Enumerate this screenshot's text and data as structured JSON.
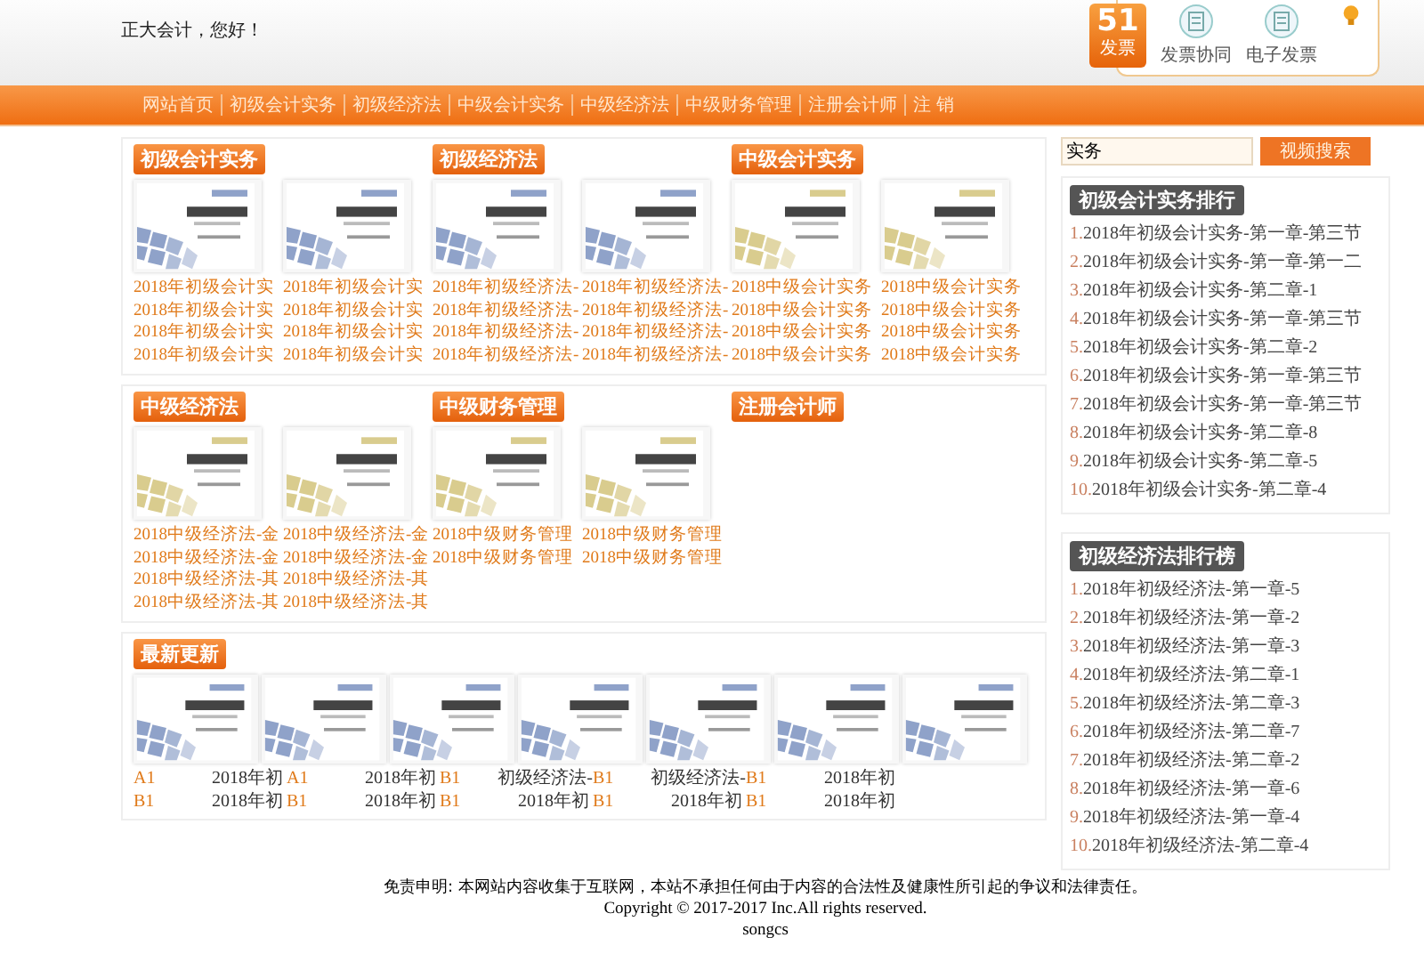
{
  "header": {
    "greeting": "正大会计，您好！",
    "badge_number": "51",
    "badge_label": "发票",
    "apps": [
      {
        "label": "发票协同"
      },
      {
        "label": "电子发票"
      }
    ]
  },
  "nav": [
    "网站首页",
    "初级会计实务",
    "初级经济法",
    "中级会计实务",
    "中级经济法",
    "中级财务管理",
    "注册会计师",
    "注 销"
  ],
  "sections": [
    {
      "title": "初级会计实务",
      "books": [
        {
          "color": "#8fa2c9",
          "links": [
            "2018年初级会计实",
            "2018年初级会计实",
            "2018年初级会计实",
            "2018年初级会计实"
          ]
        },
        {
          "color": "#8fa2c9",
          "links": [
            "2018年初级会计实",
            "2018年初级会计实",
            "2018年初级会计实",
            "2018年初级会计实"
          ]
        }
      ]
    },
    {
      "title": "初级经济法",
      "books": [
        {
          "color": "#8fa2c9",
          "links": [
            "2018年初级经济法-",
            "2018年初级经济法-",
            "2018年初级经济法-",
            "2018年初级经济法-"
          ]
        },
        {
          "color": "#8fa2c9",
          "links": [
            "2018年初级经济法-",
            "2018年初级经济法-",
            "2018年初级经济法-",
            "2018年初级经济法-"
          ]
        }
      ]
    },
    {
      "title": "中级会计实务",
      "books": [
        {
          "color": "#d9cc8e",
          "links": [
            "2018中级会计实务",
            "2018中级会计实务",
            "2018中级会计实务",
            "2018中级会计实务"
          ]
        },
        {
          "color": "#d9cc8e",
          "links": [
            "2018中级会计实务",
            "2018中级会计实务",
            "2018中级会计实务",
            "2018中级会计实务"
          ]
        }
      ]
    },
    {
      "title": "中级经济法",
      "books": [
        {
          "color": "#d9cc8e",
          "links": [
            "2018中级经济法-金",
            "2018中级经济法-金",
            "2018中级经济法-其",
            "2018中级经济法-其"
          ]
        },
        {
          "color": "#d9cc8e",
          "links": [
            "2018中级经济法-金",
            "2018中级经济法-金",
            "2018中级经济法-其",
            "2018中级经济法-其"
          ]
        }
      ]
    },
    {
      "title": "中级财务管理",
      "books": [
        {
          "color": "#d9cc8e",
          "links": [
            "2018中级财务管理",
            "2018中级财务管理"
          ]
        },
        {
          "color": "#d9cc8e",
          "links": [
            "2018中级财务管理",
            "2018中级财务管理"
          ]
        }
      ]
    },
    {
      "title": "注册会计师"
    }
  ],
  "latest": {
    "title": "最新更新",
    "books": [
      {
        "color": "#8fa2c9"
      },
      {
        "color": "#8fa2c9"
      },
      {
        "color": "#8fa2c9"
      },
      {
        "color": "#8fa2c9"
      },
      {
        "color": "#8fa2c9"
      },
      {
        "color": "#8fa2c9"
      },
      {
        "color": "#8fa2c9"
      }
    ],
    "items": [
      {
        "code": "A1",
        "title": "2018年初"
      },
      {
        "code": "A1",
        "title": "2018年初"
      },
      {
        "code": "B1",
        "title": "初级经济法-"
      },
      {
        "code": "B1",
        "title": "初级经济法-"
      },
      {
        "code": "B1",
        "title": "2018年初"
      },
      {
        "code": "B1",
        "title": "2018年初"
      },
      {
        "code": "B1",
        "title": "2018年初"
      },
      {
        "code": "B1",
        "title": "2018年初"
      },
      {
        "code": "B1",
        "title": "2018年初"
      },
      {
        "code": "B1",
        "title": "2018年初"
      }
    ]
  },
  "search": {
    "value": "实务",
    "button": "视频搜索"
  },
  "rankings": [
    {
      "title": "初级会计实务排行",
      "items": [
        {
          "rank": "1.",
          "text": "2018年初级会计实务-第一章-第三节"
        },
        {
          "rank": "2.",
          "text": "2018年初级会计实务-第一章-第一二"
        },
        {
          "rank": "3.",
          "text": "2018年初级会计实务-第二章-1"
        },
        {
          "rank": "4.",
          "text": "2018年初级会计实务-第一章-第三节"
        },
        {
          "rank": "5.",
          "text": "2018年初级会计实务-第二章-2"
        },
        {
          "rank": "6.",
          "text": "2018年初级会计实务-第一章-第三节"
        },
        {
          "rank": "7.",
          "text": "2018年初级会计实务-第一章-第三节"
        },
        {
          "rank": "8.",
          "text": "2018年初级会计实务-第二章-8"
        },
        {
          "rank": "9.",
          "text": "2018年初级会计实务-第二章-5"
        },
        {
          "rank": "10.",
          "text": "2018年初级会计实务-第二章-4"
        }
      ]
    },
    {
      "title": "初级经济法排行榜",
      "items": [
        {
          "rank": "1.",
          "text": "2018年初级经济法-第一章-5"
        },
        {
          "rank": "2.",
          "text": "2018年初级经济法-第一章-2"
        },
        {
          "rank": "3.",
          "text": "2018年初级经济法-第一章-3"
        },
        {
          "rank": "4.",
          "text": "2018年初级经济法-第二章-1"
        },
        {
          "rank": "5.",
          "text": "2018年初级经济法-第二章-3"
        },
        {
          "rank": "6.",
          "text": "2018年初级经济法-第二章-7"
        },
        {
          "rank": "7.",
          "text": "2018年初级经济法-第二章-2"
        },
        {
          "rank": "8.",
          "text": "2018年初级经济法-第一章-6"
        },
        {
          "rank": "9.",
          "text": "2018年初级经济法-第一章-4"
        },
        {
          "rank": "10.",
          "text": "2018年初级经济法-第二章-4"
        }
      ]
    }
  ],
  "footer": {
    "disclaimer": "免责申明: 本网站内容收集于互联网，本站不承担任何由于内容的合法性及健康性所引起的争议和法律责任。",
    "copyright": "Copyright © 2017-2017 Inc.All rights reserved.",
    "author": "songcs"
  }
}
